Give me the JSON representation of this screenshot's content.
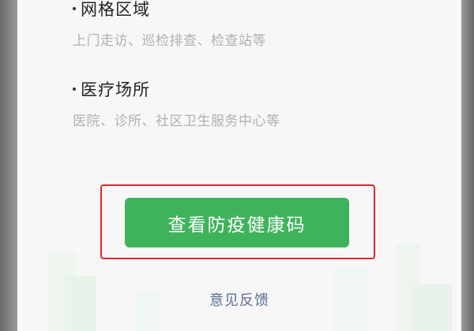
{
  "sections": [
    {
      "title": "网格区域",
      "description": "上门走访、巡检排查、检查站等"
    },
    {
      "title": "医疗场所",
      "description": "医院、诊所、社区卫生服务中心等"
    }
  ],
  "primary_button": {
    "label": "查看防疫健康码",
    "color": "#3fb35b"
  },
  "highlight_color": "#e0262c",
  "feedback_link": {
    "label": "意见反馈"
  }
}
